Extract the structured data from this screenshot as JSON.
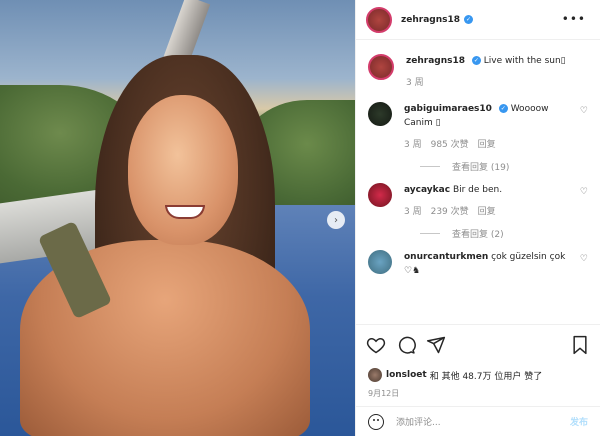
{
  "author": {
    "username": "zehragns18",
    "verified": true
  },
  "caption": {
    "username": "zehragns18",
    "text": "Live with the sun▯",
    "age": "3 周"
  },
  "comments": [
    {
      "username": "gabiguimaraes10",
      "verified": true,
      "text_inline": "Woooow",
      "text_line2": "Canim ▯",
      "age": "3 周",
      "likes": "985 次赞",
      "reply": "回复",
      "view_replies": "查看回复 (19)"
    },
    {
      "username": "aycaykac",
      "text_inline": "Bir de ben.",
      "age": "3 周",
      "likes": "239 次赞",
      "reply": "回复",
      "view_replies": "查看回复 (2)"
    },
    {
      "username": "onurcanturkmen",
      "text_inline": "çok güzelsin çok",
      "text_line2": "♡♞"
    }
  ],
  "likes_summary": {
    "user": "lonsloet",
    "rest": "和 其他 48.7万 位用户 赞了"
  },
  "date": "9月12日",
  "add_comment": {
    "placeholder": "添加评论...",
    "post": "发布"
  },
  "colors": {
    "accent": "#3897f0",
    "muted": "#8e8e8e",
    "post_button": "#b2dffc"
  }
}
